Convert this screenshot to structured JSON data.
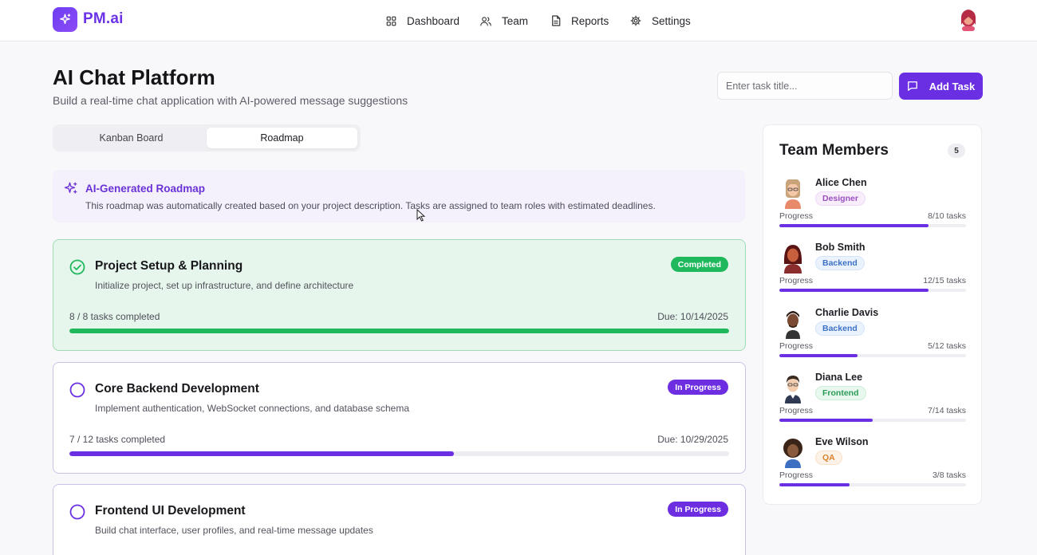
{
  "brand": {
    "name": "PM.ai",
    "accent": "#6b2fe3"
  },
  "nav": {
    "items": [
      {
        "label": "Dashboard",
        "icon": "grid-icon"
      },
      {
        "label": "Team",
        "icon": "users-icon"
      },
      {
        "label": "Reports",
        "icon": "document-icon"
      },
      {
        "label": "Settings",
        "icon": "gear-icon"
      }
    ]
  },
  "project": {
    "title": "AI Chat Platform",
    "subtitle": "Build a real-time chat application with AI-powered message suggestions"
  },
  "task_entry": {
    "placeholder": "Enter task title...",
    "button_label": "Add Task"
  },
  "tabs": [
    {
      "label": "Kanban Board",
      "active": false
    },
    {
      "label": "Roadmap",
      "active": true
    }
  ],
  "ai_banner": {
    "title": "AI-Generated Roadmap",
    "text": "This roadmap was automatically created based on your project description. Tasks are assigned to team roles with estimated deadlines."
  },
  "phases": [
    {
      "title": "Project Setup & Planning",
      "description": "Initialize project, set up infrastructure, and define architecture",
      "status": "Completed",
      "count_text": "8 / 8 tasks completed",
      "due_text": "Due: 10/14/2025",
      "progress": 1.0,
      "color": "#1fb85d"
    },
    {
      "title": "Core Backend Development",
      "description": "Implement authentication, WebSocket connections, and database schema",
      "status": "In Progress",
      "count_text": "7 / 12 tasks completed",
      "due_text": "Due: 10/29/2025",
      "progress": 0.583,
      "color": "#6b2fe3"
    },
    {
      "title": "Frontend UI Development",
      "description": "Build chat interface, user profiles, and real-time message updates",
      "status": "In Progress",
      "count_text": "",
      "due_text": "",
      "progress": 0,
      "color": "#6b2fe3"
    }
  ],
  "team": {
    "title": "Team Members",
    "count": "5",
    "progress_label": "Progress",
    "members": [
      {
        "name": "Alice Chen",
        "role": "Designer",
        "role_class": "role-designer",
        "tasks_text": "8/10 tasks",
        "progress": 0.8
      },
      {
        "name": "Bob Smith",
        "role": "Backend",
        "role_class": "role-backend",
        "tasks_text": "12/15 tasks",
        "progress": 0.8
      },
      {
        "name": "Charlie Davis",
        "role": "Backend",
        "role_class": "role-backend",
        "tasks_text": "5/12 tasks",
        "progress": 0.417
      },
      {
        "name": "Diana Lee",
        "role": "Frontend",
        "role_class": "role-frontend",
        "tasks_text": "7/14 tasks",
        "progress": 0.5
      },
      {
        "name": "Eve Wilson",
        "role": "QA",
        "role_class": "role-qa",
        "tasks_text": "3/8 tasks",
        "progress": 0.375
      }
    ]
  }
}
